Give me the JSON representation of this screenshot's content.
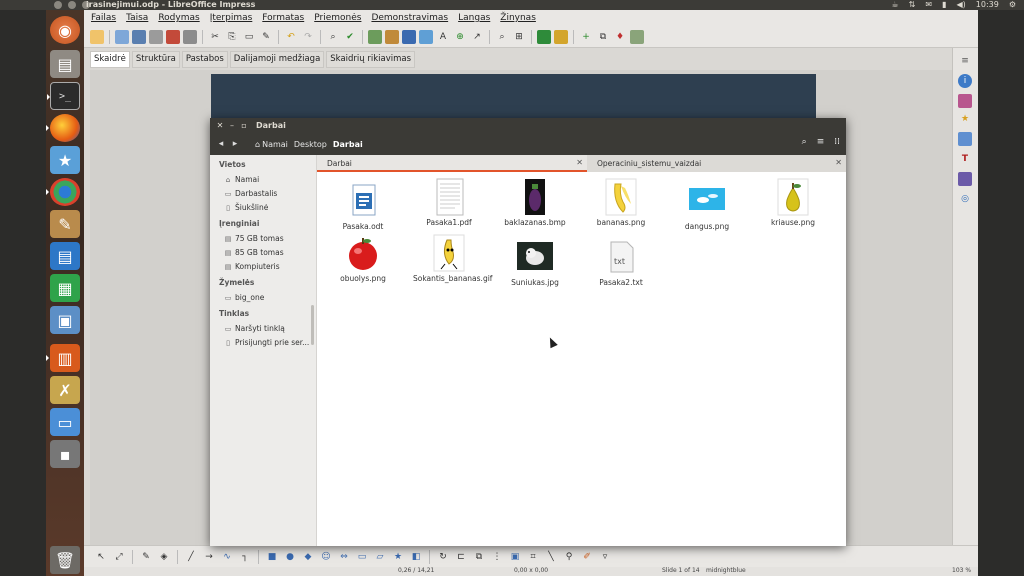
{
  "top_panel": {
    "title": "irasinejimui.odp - LibreOffice Impress",
    "clock": "10:39"
  },
  "launcher": {
    "apps": [
      "ubuntu-dash",
      "files",
      "terminal",
      "firefox",
      "software-center",
      "chromium",
      "paint",
      "writer",
      "calc",
      "draw",
      "impress",
      "system-tools",
      "screenshot",
      "workspaces",
      "trash"
    ]
  },
  "libreoffice": {
    "menu": [
      "Failas",
      "Taisa",
      "Rodymas",
      "Įterpimas",
      "Formatas",
      "Priemonės",
      "Demonstravimas",
      "Langas",
      "Žinynas"
    ],
    "view_tabs": [
      "Skaidrė",
      "Struktūra",
      "Pastabos",
      "Dalijamoji medžiaga",
      "Skaidrių rikiavimas"
    ],
    "status": {
      "position": "0,26 / 14,21",
      "size": "0,00 x 0,00",
      "slide": "Slide 1 of 14",
      "theme": "midnightblue",
      "zoom": "103 %"
    }
  },
  "files_window": {
    "title": "Darbai",
    "breadcrumb": [
      "Namai",
      "Desktop",
      "Darbai"
    ],
    "sidebar": {
      "places_header": "Vietos",
      "places": [
        "Namai",
        "Darbastalis",
        "Šiukšlinė"
      ],
      "devices_header": "Įrenginiai",
      "devices": [
        "75 GB tomas",
        "85 GB tomas",
        "Kompiuteris"
      ],
      "bookmarks_header": "Žymelės",
      "bookmarks": [
        "big_one"
      ],
      "network_header": "Tinklas",
      "network": [
        "Naršyti tinklą",
        "Prisijungti prie ser..."
      ]
    },
    "tabs": [
      "Darbai",
      "Operaciniu_sistemu_vaizdai"
    ],
    "files": [
      {
        "name": "Pasaka.odt",
        "icon": "odt-document-icon"
      },
      {
        "name": "Pasaka1.pdf",
        "icon": "pdf-document-icon"
      },
      {
        "name": "baklazanas.bmp",
        "icon": "eggplant-image-icon"
      },
      {
        "name": "bananas.png",
        "icon": "banana-image-icon"
      },
      {
        "name": "dangus.png",
        "icon": "sky-image-icon"
      },
      {
        "name": "kriause.png",
        "icon": "pear-image-icon"
      },
      {
        "name": "obuolys.png",
        "icon": "apple-image-icon"
      },
      {
        "name": "Sokantis_bananas.gif",
        "icon": "dancing-banana-icon"
      },
      {
        "name": "Suniukas.jpg",
        "icon": "puppy-image-icon"
      },
      {
        "name": "Pasaka2.txt",
        "icon": "txt-document-icon"
      }
    ]
  }
}
